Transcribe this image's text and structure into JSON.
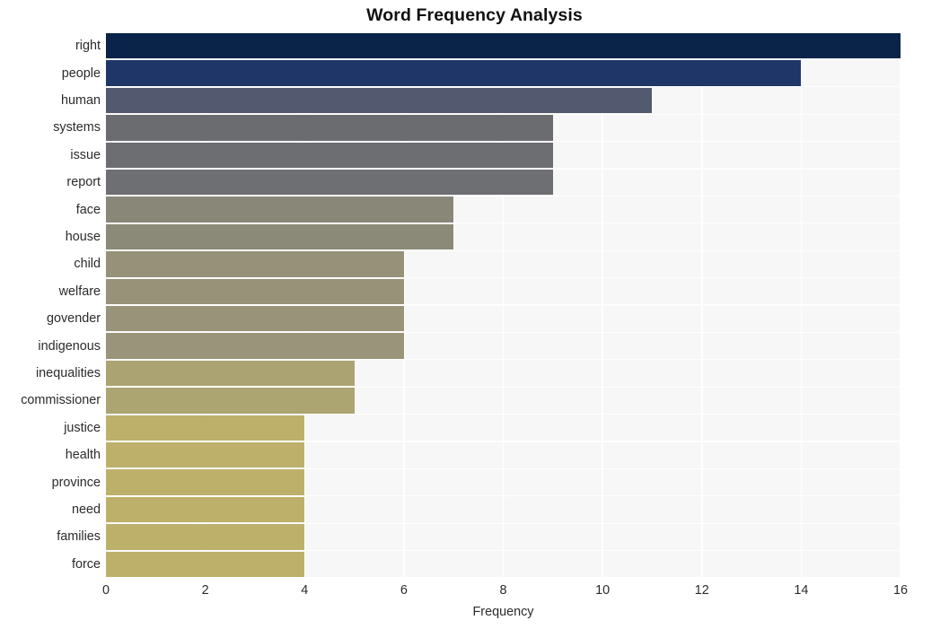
{
  "chart_data": {
    "type": "bar",
    "orientation": "horizontal",
    "title": "Word Frequency Analysis",
    "xlabel": "Frequency",
    "ylabel": "",
    "categories": [
      "right",
      "people",
      "human",
      "systems",
      "issue",
      "report",
      "face",
      "house",
      "child",
      "welfare",
      "govender",
      "indigenous",
      "inequalities",
      "commissioner",
      "justice",
      "health",
      "province",
      "need",
      "families",
      "force"
    ],
    "values": [
      16,
      14,
      11,
      9,
      9,
      9,
      7,
      7,
      6,
      6,
      6,
      6,
      5,
      5,
      4,
      4,
      4,
      4,
      4,
      4
    ],
    "xlim": [
      0,
      16
    ],
    "xticks": [
      0,
      2,
      4,
      6,
      8,
      10,
      12,
      14,
      16
    ],
    "xtick_labels": [
      "0",
      "2",
      "4",
      "6",
      "8",
      "10",
      "12",
      "14",
      "16"
    ],
    "grid": true,
    "grid_color": "#ffffff",
    "plot_background": "#f7f7f7",
    "legend": false,
    "bar_colors": [
      "#0a2348",
      "#1e3768",
      "#535a70",
      "#6b6c70",
      "#6d6e72",
      "#6e6f73",
      "#898778",
      "#8b8978",
      "#979179",
      "#989279",
      "#99937a",
      "#9a947a",
      "#aba472",
      "#aca572",
      "#bdb06a",
      "#bdb06a",
      "#bdb06a",
      "#bdb06a",
      "#bdb06a",
      "#bdb06a"
    ]
  }
}
